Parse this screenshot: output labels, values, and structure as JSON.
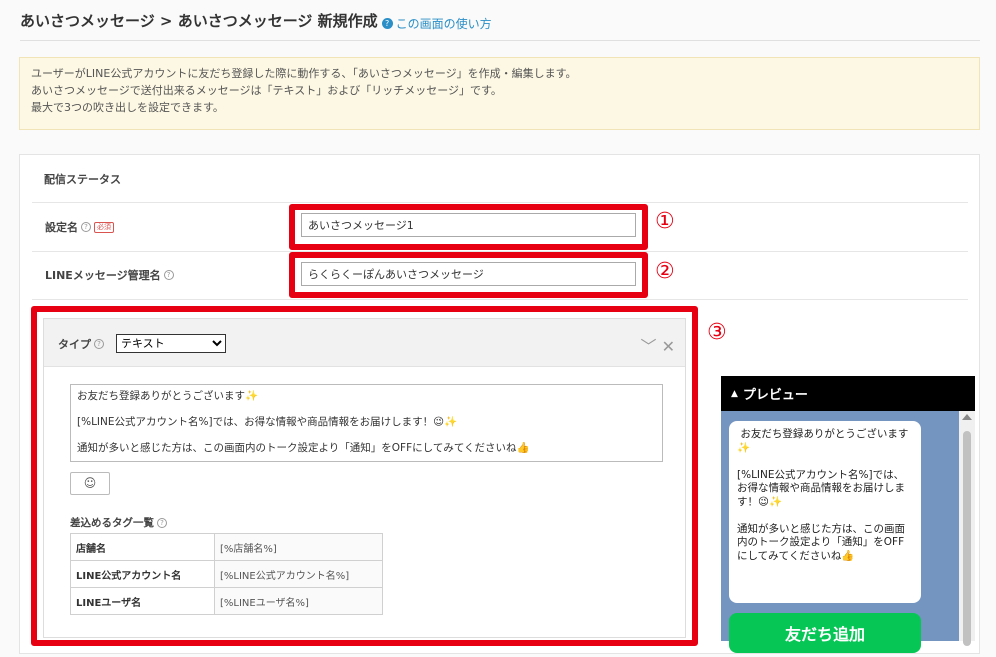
{
  "header": {
    "title": "あいさつメッセージ > あいさつメッセージ 新規作成",
    "help_link": "この画面の使い方"
  },
  "notice": {
    "lines": [
      "ユーザーがLINE公式アカウントに友だち登録した際に動作する、「あいさつメッセージ」を作成・編集します。",
      "あいさつメッセージで送付出来るメッセージは「テキスト」および「リッチメッセージ」です。",
      "最大で3つの吹き出しを設定できます。"
    ]
  },
  "form": {
    "section_title": "配信ステータス",
    "setting_name_label": "設定名",
    "required_badge": "必須",
    "setting_name_value": "あいさつメッセージ1",
    "line_name_label": "LINEメッセージ管理名",
    "line_name_value": "らくらくーぽんあいさつメッセージ",
    "type_label": "タイプ",
    "type_value": "テキスト",
    "message": "お友だち登録ありがとうございます✨\n\n[%LINE公式アカウント名%]では、お得な情報や商品情報をお届けします！😉✨\n\n通知が多いと感じた方は、この画面内のトーク設定より「通知」をOFFにしてみてくださいね👍",
    "emoji_button": "☺",
    "tags_title": "差込めるタグ一覧",
    "tags": [
      {
        "key": "店舗名",
        "value": "[%店舗名%]"
      },
      {
        "key": "LINE公式アカウント名",
        "value": "[%LINE公式アカウント名%]"
      },
      {
        "key": "LINEユーザ名",
        "value": "[%LINEユーザ名%]"
      }
    ]
  },
  "annotations": {
    "one": "①",
    "two": "②",
    "three": "③",
    "highlight_color": "#e60012"
  },
  "preview": {
    "title": "プレビュー",
    "bubble_text": " お友だち登録ありがとうございます✨\n\n[%LINE公式アカウント名%]では、お得な情報や商品情報をお届けします！😉✨\n\n通知が多いと感じた方は、この画面内のトーク設定より「通知」をOFFにしてみてくださいね👍",
    "friend_button": "友だち追加",
    "background_color": "#7595c1"
  }
}
